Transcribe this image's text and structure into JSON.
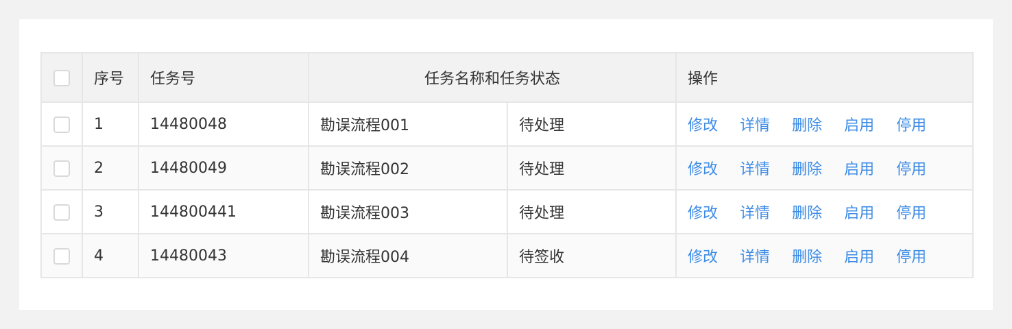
{
  "table": {
    "headers": {
      "select": "",
      "index": "序号",
      "task_no": "任务号",
      "task_name_status": "任务名称和任务状态",
      "actions": "操作"
    },
    "rows": [
      {
        "index": "1",
        "task_no": "14480048",
        "task_name": "勘误流程001",
        "status": "待处理"
      },
      {
        "index": "2",
        "task_no": "14480049",
        "task_name": "勘误流程002",
        "status": "待处理"
      },
      {
        "index": "3",
        "task_no": "144800441",
        "task_name": "勘误流程003",
        "status": "待处理"
      },
      {
        "index": "4",
        "task_no": "14480043",
        "task_name": "勘误流程004",
        "status": "待签收"
      }
    ],
    "actions": [
      "修改",
      "详情",
      "删除",
      "启用",
      "停用"
    ]
  },
  "colors": {
    "link": "#3d8ce6",
    "header_bg": "#f2f2f2",
    "border": "#e6e6e6"
  }
}
